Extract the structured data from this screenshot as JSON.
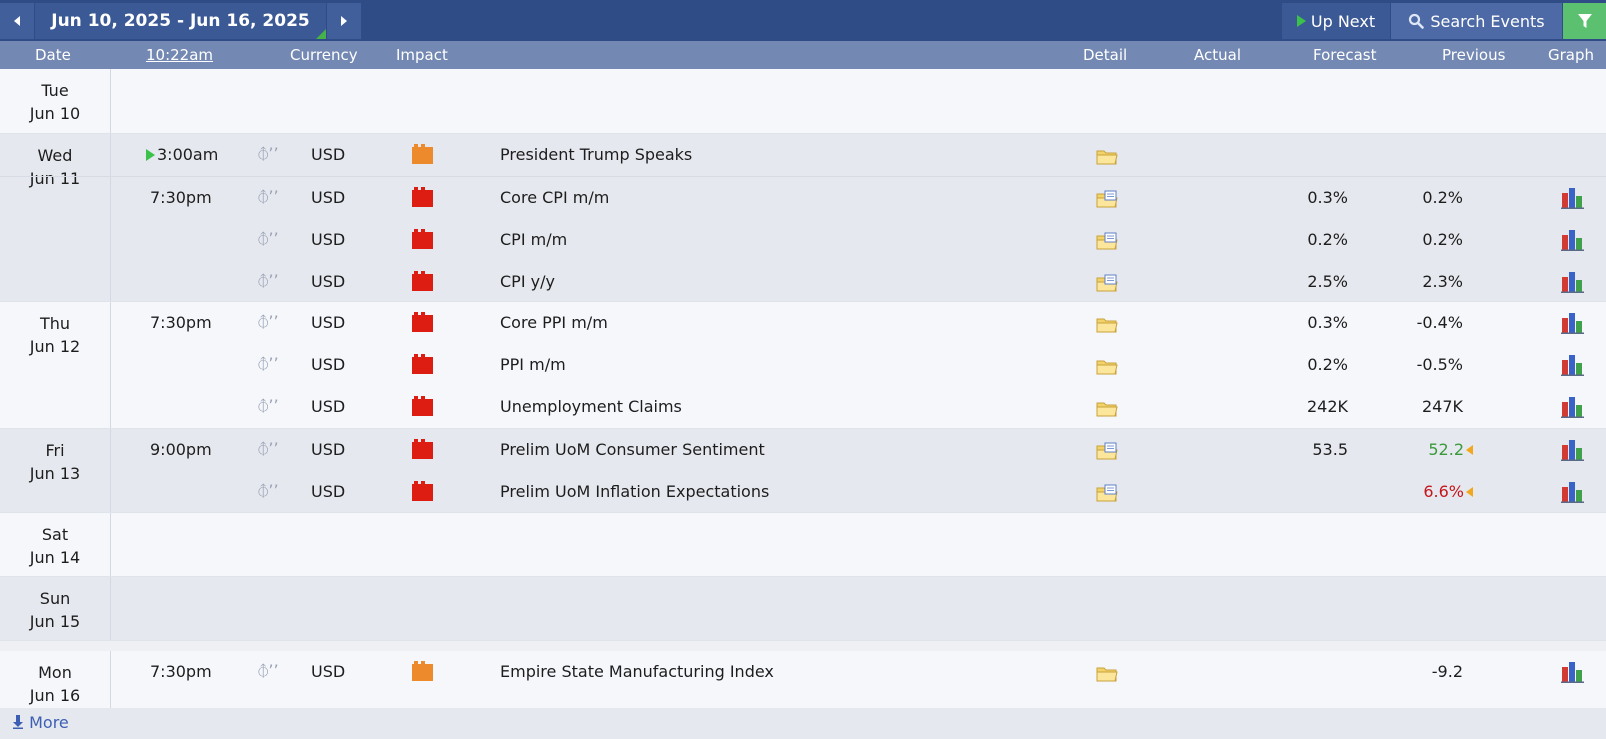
{
  "toolbar": {
    "date_range": "Jun 10, 2025 - Jun 16, 2025",
    "up_next_label": "Up Next",
    "search_label": "Search Events",
    "prev_icon": "triangle-left-icon",
    "next_icon": "triangle-right-icon",
    "filter_icon": "funnel-icon",
    "accent_color": "#2f4c86",
    "filter_color": "#5cc071"
  },
  "columns": {
    "date": "Date",
    "time": "10:22am",
    "currency": "Currency",
    "impact": "Impact",
    "detail": "Detail",
    "actual": "Actual",
    "forecast": "Forecast",
    "previous": "Previous",
    "graph": "Graph"
  },
  "days": [
    {
      "weekday": "Tue",
      "date": "Jun 10",
      "events": []
    },
    {
      "weekday": "Wed",
      "date": "Jun 11",
      "events": [
        {
          "time": "3:00am",
          "up_next": true,
          "currency": "USD",
          "impact": "medium",
          "title": "President Trump Speaks",
          "detail_icon": "folder-icon",
          "forecast": "",
          "previous": "",
          "graph": false
        },
        {
          "time": "7:30pm",
          "currency": "USD",
          "impact": "high",
          "title": "Core CPI m/m",
          "detail_icon": "folder-doc-icon",
          "forecast": "0.3%",
          "previous": "0.2%",
          "graph": true
        },
        {
          "time": "",
          "currency": "USD",
          "impact": "high",
          "title": "CPI m/m",
          "detail_icon": "folder-doc-icon",
          "forecast": "0.2%",
          "previous": "0.2%",
          "graph": true
        },
        {
          "time": "",
          "currency": "USD",
          "impact": "high",
          "title": "CPI y/y",
          "detail_icon": "folder-doc-icon",
          "forecast": "2.5%",
          "previous": "2.3%",
          "graph": true
        }
      ]
    },
    {
      "weekday": "Thu",
      "date": "Jun 12",
      "events": [
        {
          "time": "7:30pm",
          "currency": "USD",
          "impact": "high",
          "title": "Core PPI m/m",
          "detail_icon": "folder-icon",
          "forecast": "0.3%",
          "previous": "-0.4%",
          "graph": true
        },
        {
          "time": "",
          "currency": "USD",
          "impact": "high",
          "title": "PPI m/m",
          "detail_icon": "folder-icon",
          "forecast": "0.2%",
          "previous": "-0.5%",
          "graph": true
        },
        {
          "time": "",
          "currency": "USD",
          "impact": "high",
          "title": "Unemployment Claims",
          "detail_icon": "folder-icon",
          "forecast": "242K",
          "previous": "247K",
          "graph": true
        }
      ]
    },
    {
      "weekday": "Fri",
      "date": "Jun 13",
      "events": [
        {
          "time": "9:00pm",
          "currency": "USD",
          "impact": "high",
          "title": "Prelim UoM Consumer Sentiment",
          "detail_icon": "folder-doc-icon",
          "forecast": "53.5",
          "previous": "52.2",
          "previous_color": "green",
          "revised": true,
          "graph": true
        },
        {
          "time": "",
          "currency": "USD",
          "impact": "high",
          "title": "Prelim UoM Inflation Expectations",
          "detail_icon": "folder-doc-icon",
          "forecast": "",
          "previous": "6.6%",
          "previous_color": "red",
          "revised": true,
          "graph": true
        }
      ]
    },
    {
      "weekday": "Sat",
      "date": "Jun 14",
      "events": []
    },
    {
      "weekday": "Sun",
      "date": "Jun 15",
      "events": []
    },
    {
      "weekday": "Mon",
      "date": "Jun 16",
      "events": [
        {
          "time": "7:30pm",
          "currency": "USD",
          "impact": "medium",
          "title": "Empire State Manufacturing Index",
          "detail_icon": "folder-icon",
          "forecast": "",
          "previous": "-9.2",
          "graph": true
        }
      ]
    }
  ],
  "footer": {
    "more_label": "More",
    "more_icon": "download-arrow-icon"
  }
}
